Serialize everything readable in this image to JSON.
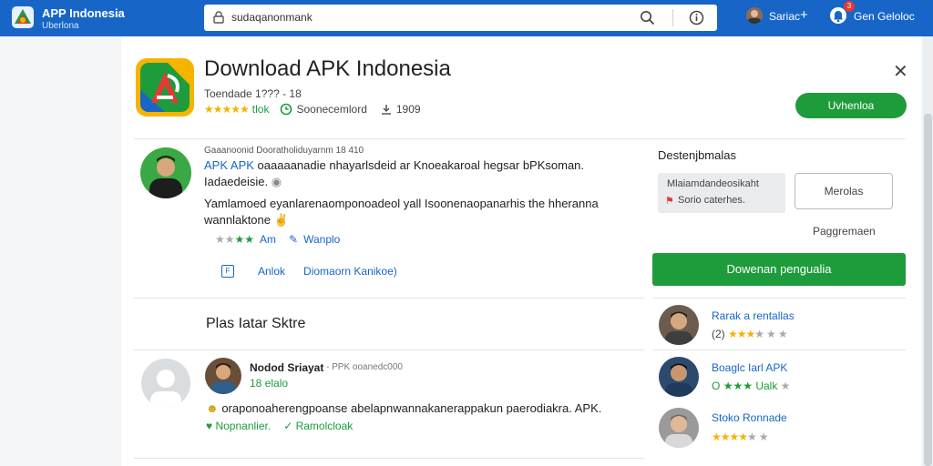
{
  "topbar": {
    "brand_title": "APP Indonesia",
    "brand_subtitle": "Uberlona",
    "search_value": "sudaqanonmank",
    "user_name": "Sariac",
    "notif_count": "3",
    "notif_label": "Gen Geloloc",
    "colors": {
      "bar": "#1766c7"
    }
  },
  "app": {
    "title": "Download APK Indonesia",
    "meta": "Toendade 1??? - 18",
    "rating_label": "tlok",
    "installs": "Soonecemlord",
    "downloads": "1909",
    "primary_button": "Uvhenloa"
  },
  "description": {
    "header": "Gaaanoonid Dooratholiduyarnm 18 410",
    "link_text": "APK APK",
    "line1": "oaaaaanadie nhayarlsdeid ar Knoeakaroal hegsar bPKsoman.",
    "line2": "Iadaedeisie.",
    "line3": "Yamlamoed eyanlarenaomponoadeol yall Isoonenaopanarhis the hheranna",
    "line4": "wannlaktone",
    "rating_label": "Am",
    "edit_label": "Wanplo",
    "action1": "Anlok",
    "action2": "Diomaorn Kanikoe)"
  },
  "side": {
    "title": "Destenjbmalas",
    "box_line1": "Mlaiamdandeosikaht",
    "box_line2": "Sorio caterhes.",
    "outline_button": "Merolas",
    "link": "Paggremaen",
    "download_button": "Dowenan pengualia"
  },
  "comments": {
    "section_title": "Plas Iatar Sktre",
    "name": "Nodod Sriayat",
    "meta": "- PPK ooanedc000",
    "rating": "18 elalo",
    "text": "oraponoaherengpoanse abelapnwannakanerappakun paerodiakra. APK.",
    "action1": "Nopnanlier.",
    "action2": "Ramolcloak"
  },
  "reviewers": [
    {
      "name": "Rarak a rentallas",
      "prefix": "(2)"
    },
    {
      "name": "Boaglc Iarl APK",
      "prefix": "O",
      "suffix": "Ualk"
    },
    {
      "name": "Stoko Ronnade",
      "prefix": ""
    }
  ]
}
